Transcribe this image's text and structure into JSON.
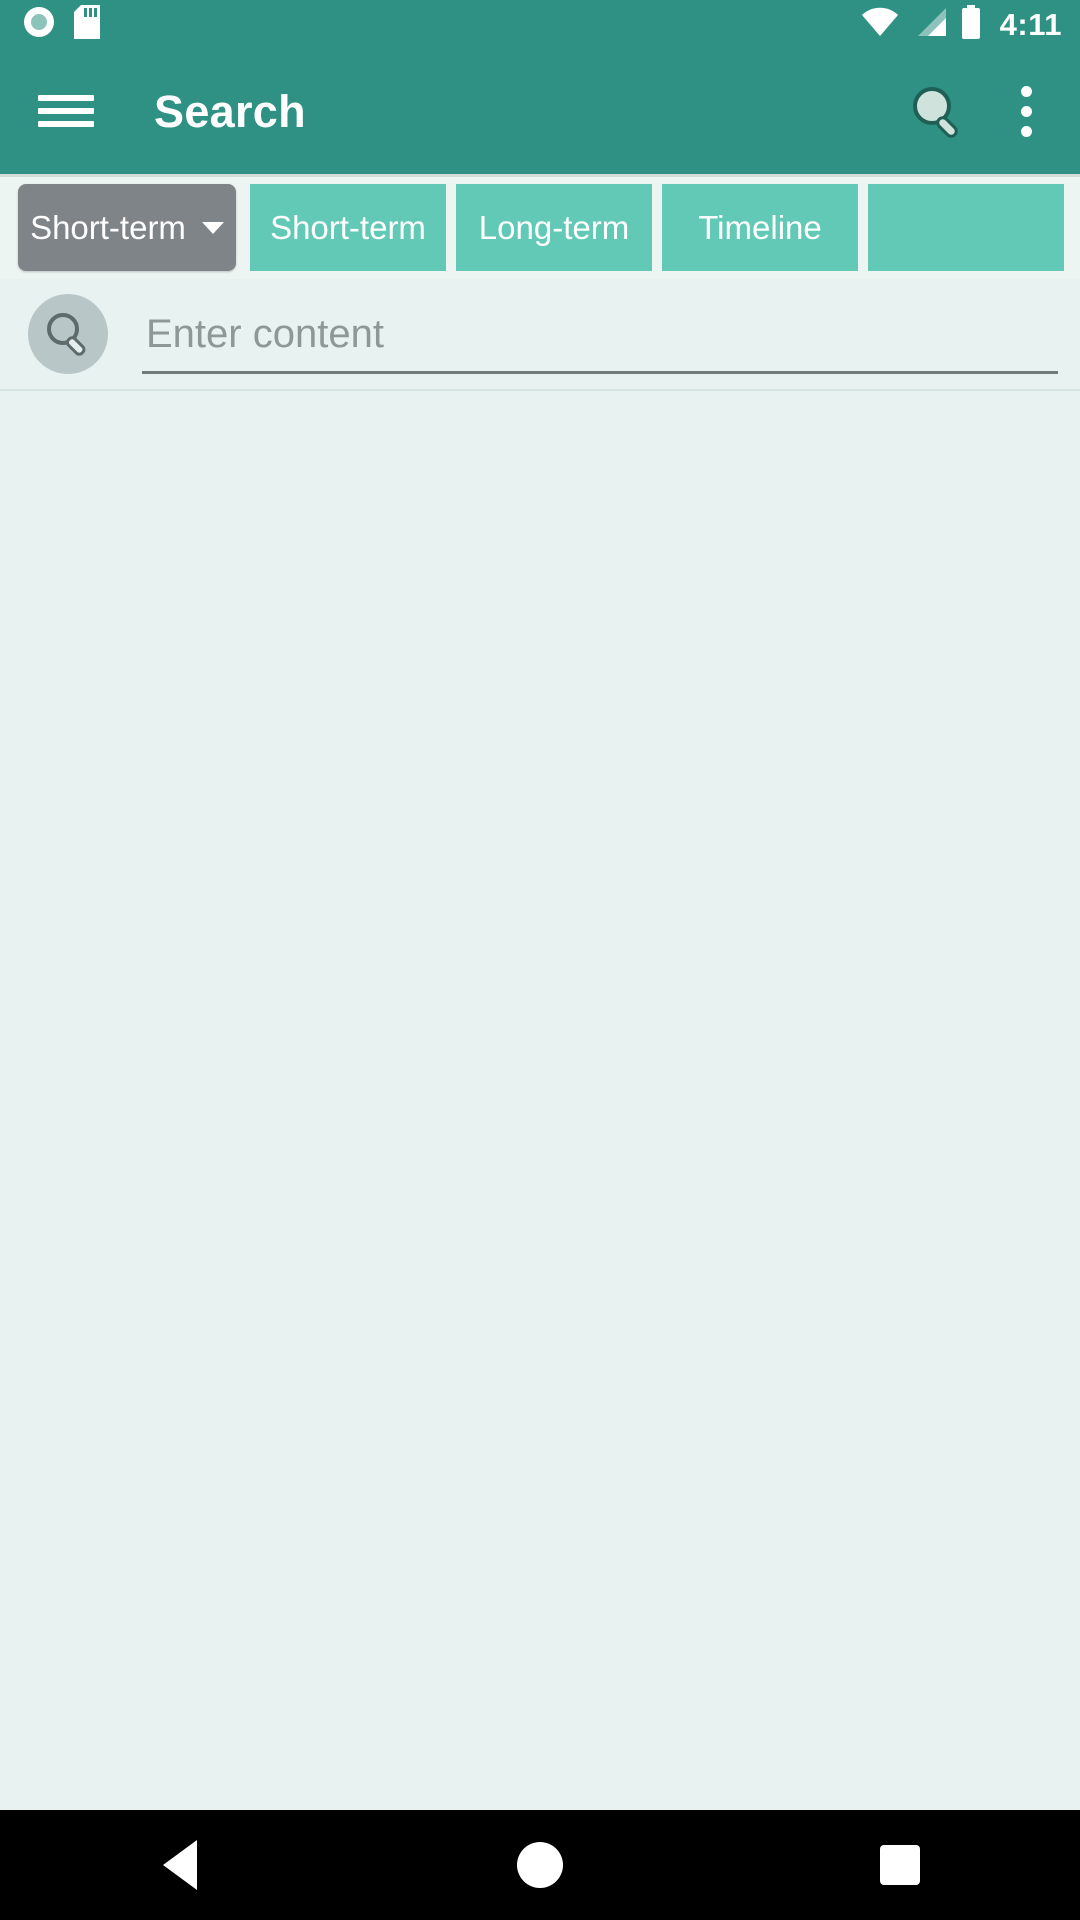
{
  "status_bar": {
    "time": "4:11",
    "icons_left": [
      "record-circle-icon",
      "sd-card-icon"
    ],
    "icons_right": [
      "wifi-icon",
      "cellular-signal-icon",
      "battery-icon"
    ],
    "background_color": "#2E9183"
  },
  "app_bar": {
    "title": "Search",
    "menu_icon": "hamburger-menu-icon",
    "search_icon": "search-icon",
    "overflow_icon": "overflow-menu-icon",
    "background_color": "#2E9183",
    "text_color": "#FFFFFF"
  },
  "tabs": {
    "spinner": {
      "label": "Short-term",
      "caret_icon": "chevron-down-icon",
      "background_color": "#7F8488"
    },
    "items": [
      {
        "label": "Short-term",
        "selected": false
      },
      {
        "label": "Long-term",
        "selected": false
      },
      {
        "label": "Timeline",
        "selected": false
      },
      {
        "label": "",
        "selected": false
      }
    ],
    "tab_color": "#62C9B6",
    "strip_background": "#EDF5F3"
  },
  "search": {
    "button_icon": "search-icon",
    "placeholder": "Enter content",
    "value": ""
  },
  "content": {
    "background_color": "#E8F3F1",
    "items": []
  },
  "nav_bar": {
    "back_label": "back-button",
    "home_label": "home-button",
    "recents_label": "recents-button",
    "background_color": "#000000"
  }
}
